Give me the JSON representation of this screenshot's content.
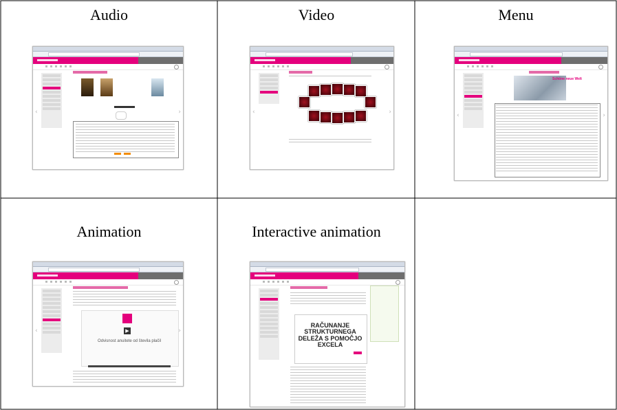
{
  "grid": {
    "labels": {
      "audio": "Audio",
      "video": "Video",
      "menu": "Menu",
      "animation": "Animation",
      "interactive_animation": "Interactive animation"
    }
  },
  "thumbnails": {
    "audio": {
      "page_title": "VENEERDNEL ZUM KINO"
    },
    "video": {
      "page_title": "BOLLYWOOD"
    },
    "menu": {
      "page_title": "BURO DER ZUKUNFT",
      "poster_text": "Schöne neue Welt"
    },
    "animation": {
      "page_title": "ODVEDNOST ANUITETE OD ŠTEVILA PLAČIL",
      "caption": "Odvisnost anuitete od števila plačil"
    },
    "interactive": {
      "page_title": "RAČUNANJE Z EXCELOM",
      "big_title": "RAČUNANJE STRUKTURNEGA DELEŽA S POMOČJO EXCELA"
    }
  },
  "colors": {
    "brand": "#e4007d",
    "border": "#000000"
  }
}
